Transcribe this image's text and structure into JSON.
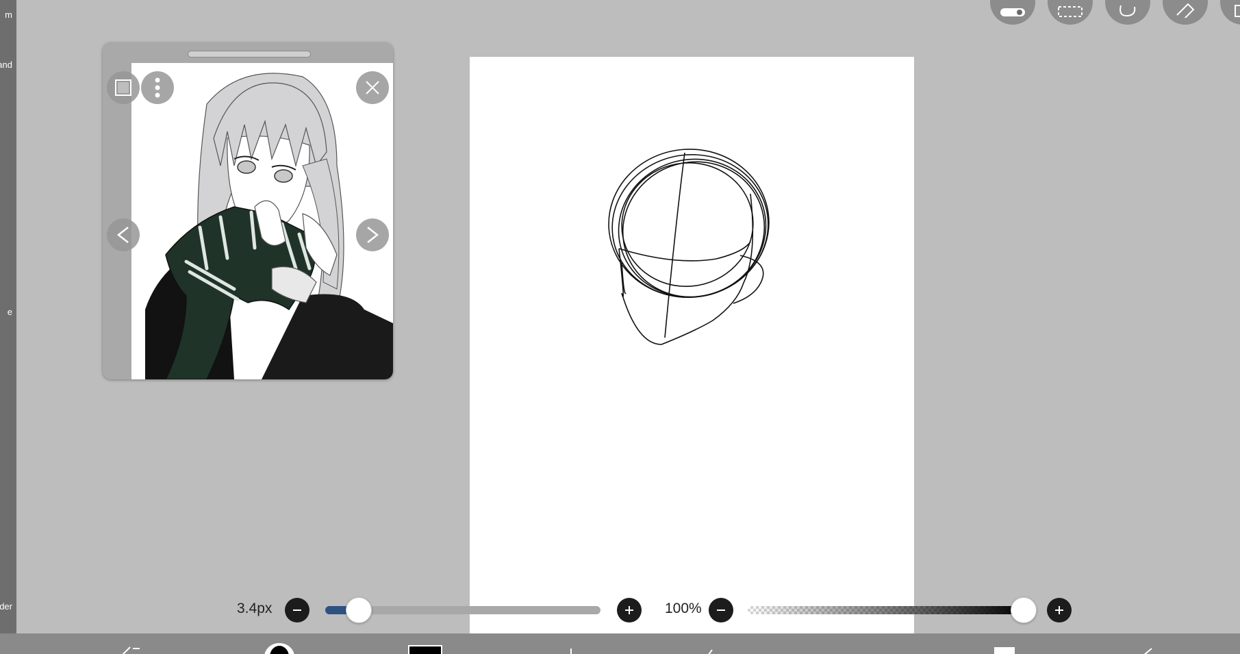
{
  "left_strip": {
    "labels": [
      "m",
      "and",
      "e",
      "der"
    ]
  },
  "top_toolbar": {
    "buttons": [
      "toggle-icon",
      "selection-icon",
      "lasso-icon",
      "ruler-icon",
      "layer-icon"
    ]
  },
  "reference_window": {
    "left_nav": "<",
    "right_nav": ">"
  },
  "brush": {
    "size_label": "3.4px",
    "size_fraction": 0.12
  },
  "opacity": {
    "zoom_label": "100%",
    "opacity_fraction": 0.99
  },
  "colors": {
    "accent": "#2d5280",
    "canvas": "#ffffff",
    "workspace": "#bdbdbd"
  }
}
